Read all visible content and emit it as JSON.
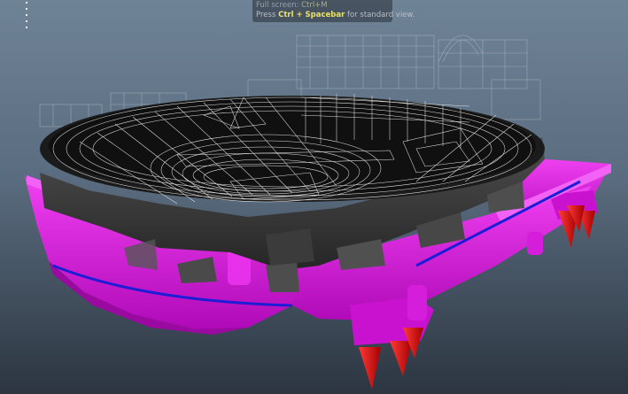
{
  "viewport": {
    "hint": {
      "line1_prefix": "Full screen:",
      "line1_key": "Ctrl+M",
      "line2_prefix": "Press",
      "line2_key": "Ctrl + Spacebar",
      "line2_suffix": "for standard view."
    },
    "colors": {
      "background_top": "#6f8397",
      "background_bottom": "#2c3540",
      "base_magenta": "#e214e6",
      "base_shadow": "#9a0aa0",
      "blue_trim": "#1d1dd6",
      "spike_red": "#ee1111",
      "rock_gray": "#3a3a3a",
      "wireframe": "#e0e0e0"
    },
    "icons": [
      "viewport-axis-ticks"
    ]
  }
}
